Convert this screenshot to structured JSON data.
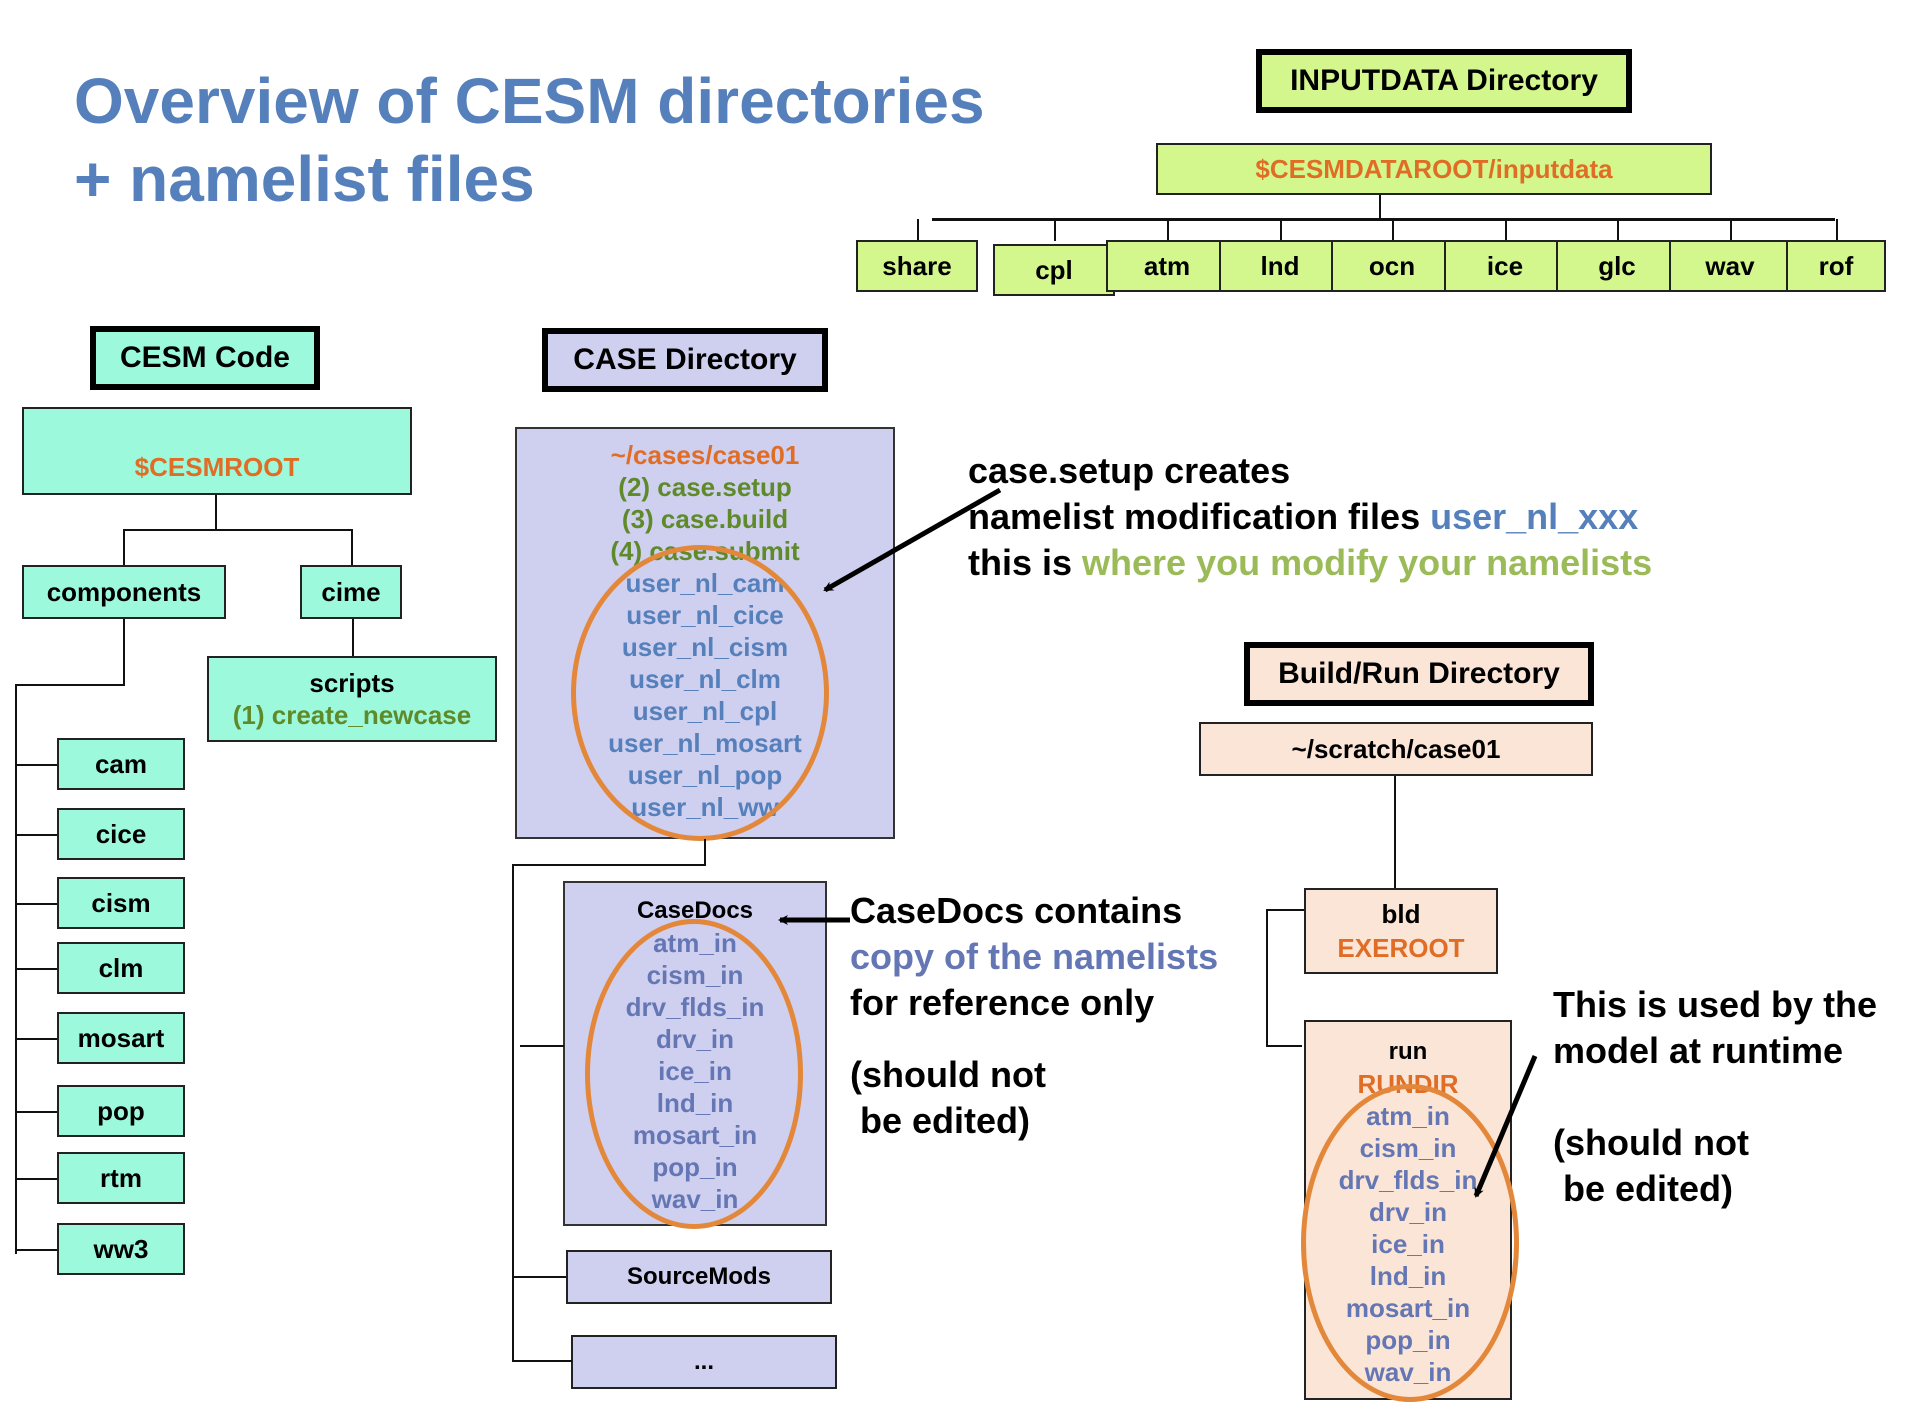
{
  "title": {
    "line1": "Overview of CESM directories",
    "line2": "+ namelist files"
  },
  "inputdata": {
    "header": "INPUTDATA Directory",
    "root": "$CESMDATAROOT/inputdata",
    "children": [
      "share",
      "cpl",
      "atm",
      "lnd",
      "ocn",
      "ice",
      "glc",
      "wav",
      "rof"
    ]
  },
  "cesm_code": {
    "header": "CESM Code",
    "root": "$CESMROOT",
    "components_label": "components",
    "cime_label": "cime",
    "scripts_label": "scripts",
    "scripts_step": "(1) create_newcase",
    "components": [
      "cam",
      "cice",
      "cism",
      "clm",
      "mosart",
      "pop",
      "rtm",
      "ww3"
    ]
  },
  "case_dir": {
    "header": "CASE Directory",
    "path": "~/cases/case01",
    "steps": [
      "(2) case.setup",
      "(3) case.build",
      "(4) case.submit"
    ],
    "user_nl": [
      "user_nl_cam",
      "user_nl_cice",
      "user_nl_cism",
      "user_nl_clm",
      "user_nl_cpl",
      "user_nl_mosart",
      "user_nl_pop",
      "user_nl_ww"
    ],
    "casedocs_label": "CaseDocs",
    "casedocs_files": [
      "atm_in",
      "cism_in",
      "drv_flds_in",
      "drv_in",
      "ice_in",
      "lnd_in",
      "mosart_in",
      "pop_in",
      "wav_in"
    ],
    "sourcemods_label": "SourceMods",
    "more_label": "..."
  },
  "build_run": {
    "header": "Build/Run Directory",
    "root": "~/scratch/case01",
    "bld_label": "bld",
    "bld_var": "EXEROOT",
    "run_label": "run",
    "run_var": "RUNDIR",
    "run_files": [
      "atm_in",
      "cism_in",
      "drv_flds_in",
      "drv_in",
      "ice_in",
      "lnd_in",
      "mosart_in",
      "pop_in",
      "wav_in"
    ]
  },
  "notes": {
    "setup": {
      "line1": "case.setup creates",
      "line2_a": "namelist modification files ",
      "line2_b": "user_nl_xxx",
      "line3_a": "this is ",
      "line3_b": "where you modify your namelists"
    },
    "casedocs": {
      "line1": "CaseDocs contains",
      "line2": "copy of the namelists",
      "line3": "for reference only",
      "line4": "(should not",
      "line5": " be edited)"
    },
    "runtime": {
      "line1": "This is used by the",
      "line2": "model at runtime",
      "line3": "(should not",
      "line4": " be edited)"
    }
  }
}
